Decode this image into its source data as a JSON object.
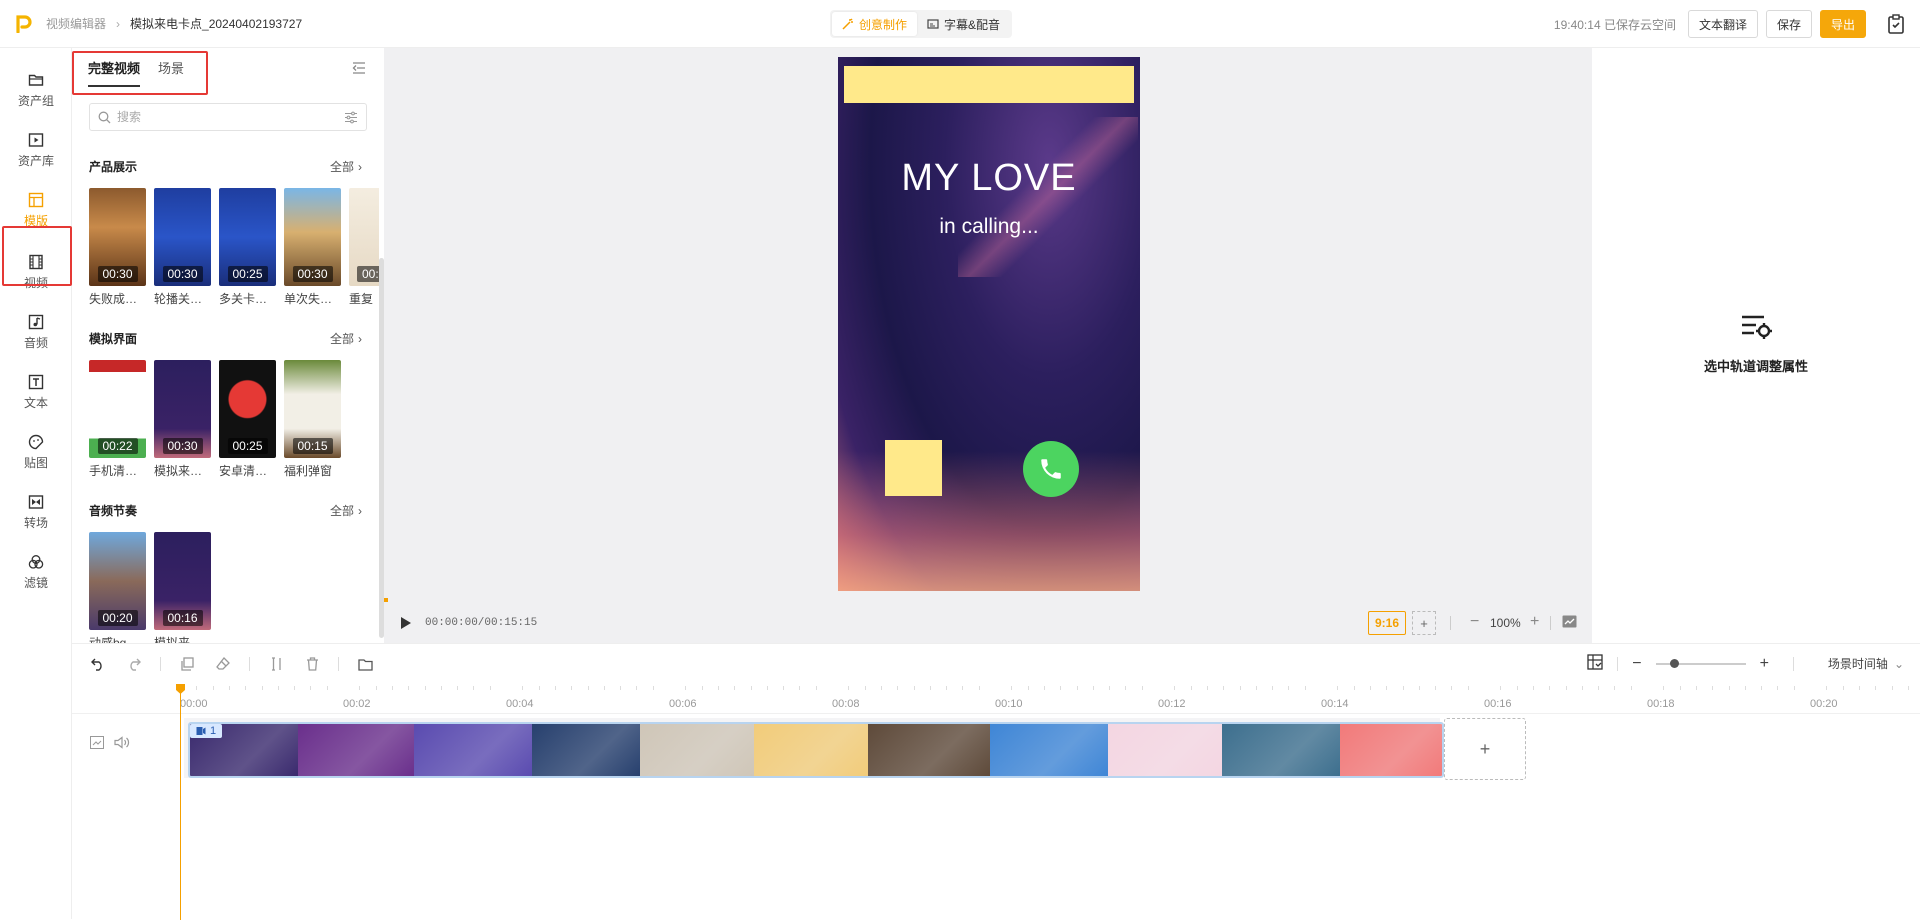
{
  "topbar": {
    "breadcrumb_root": "视频编辑器",
    "project_name": "模拟来电卡点_20240402193727",
    "modes": [
      {
        "label": "创意制作",
        "active": true
      },
      {
        "label": "字幕&配音",
        "active": false
      }
    ],
    "save_status": "19:40:14 已保存云空间",
    "translate_label": "文本翻译",
    "save_label": "保存",
    "export_label": "导出"
  },
  "leftnav": [
    {
      "label": "资产组",
      "icon": "folder-icon"
    },
    {
      "label": "资产库",
      "icon": "media-library-icon"
    },
    {
      "label": "模版",
      "icon": "template-icon",
      "active": true
    },
    {
      "label": "视频",
      "icon": "film-icon"
    },
    {
      "label": "音频",
      "icon": "music-icon"
    },
    {
      "label": "文本",
      "icon": "text-icon"
    },
    {
      "label": "贴图",
      "icon": "sticker-icon"
    },
    {
      "label": "转场",
      "icon": "transition-icon"
    },
    {
      "label": "滤镜",
      "icon": "filter-icon"
    }
  ],
  "panel": {
    "tabs": [
      {
        "label": "完整视频",
        "active": true
      },
      {
        "label": "场景",
        "active": false
      }
    ],
    "search_placeholder": "搜索",
    "sections": [
      {
        "title": "产品展示",
        "all": "全部",
        "items": [
          {
            "name": "失败成…",
            "duration": "00:30"
          },
          {
            "name": "轮播关…",
            "duration": "00:30"
          },
          {
            "name": "多关卡…",
            "duration": "00:25"
          },
          {
            "name": "单次失…",
            "duration": "00:30"
          },
          {
            "name": "重复",
            "duration": "00:"
          }
        ]
      },
      {
        "title": "模拟界面",
        "all": "全部",
        "items": [
          {
            "name": "手机清…",
            "duration": "00:22"
          },
          {
            "name": "模拟来…",
            "duration": "00:30"
          },
          {
            "name": "安卓清…",
            "duration": "00:25"
          },
          {
            "name": "福利弹窗",
            "duration": "00:15"
          }
        ]
      },
      {
        "title": "音频节奏",
        "all": "全部",
        "items": [
          {
            "name": "动感bg…",
            "duration": "00:20"
          },
          {
            "name": "模拟来…",
            "duration": "00:16"
          }
        ]
      }
    ]
  },
  "preview": {
    "title": "MY LOVE",
    "subtitle": "in calling...",
    "timecode": "00:00:00/00:15:15",
    "ratio": "9:16",
    "zoom": "100%"
  },
  "props": {
    "hint": "选中轨道调整属性"
  },
  "timeline": {
    "scene_mode": "场景时间轴",
    "ticks": [
      "00:00",
      "00:02",
      "00:04",
      "00:06",
      "00:08",
      "00:10",
      "00:12",
      "00:14",
      "00:16",
      "00:18",
      "00:20"
    ],
    "track_badge": "1",
    "clip_colors": [
      "#3a2a6e",
      "#6a2f8c",
      "#5a4bb0",
      "#27406e",
      "#cfc6b8",
      "#f2cc7a",
      "#5e4a3a",
      "#3f86d6",
      "#f4d6e2",
      "#3d6f8e",
      "#f27a7a"
    ],
    "clip_widths": [
      110,
      118,
      120,
      110,
      116,
      116,
      124,
      120,
      116,
      120,
      104
    ]
  },
  "accent_color": "#f5a000"
}
